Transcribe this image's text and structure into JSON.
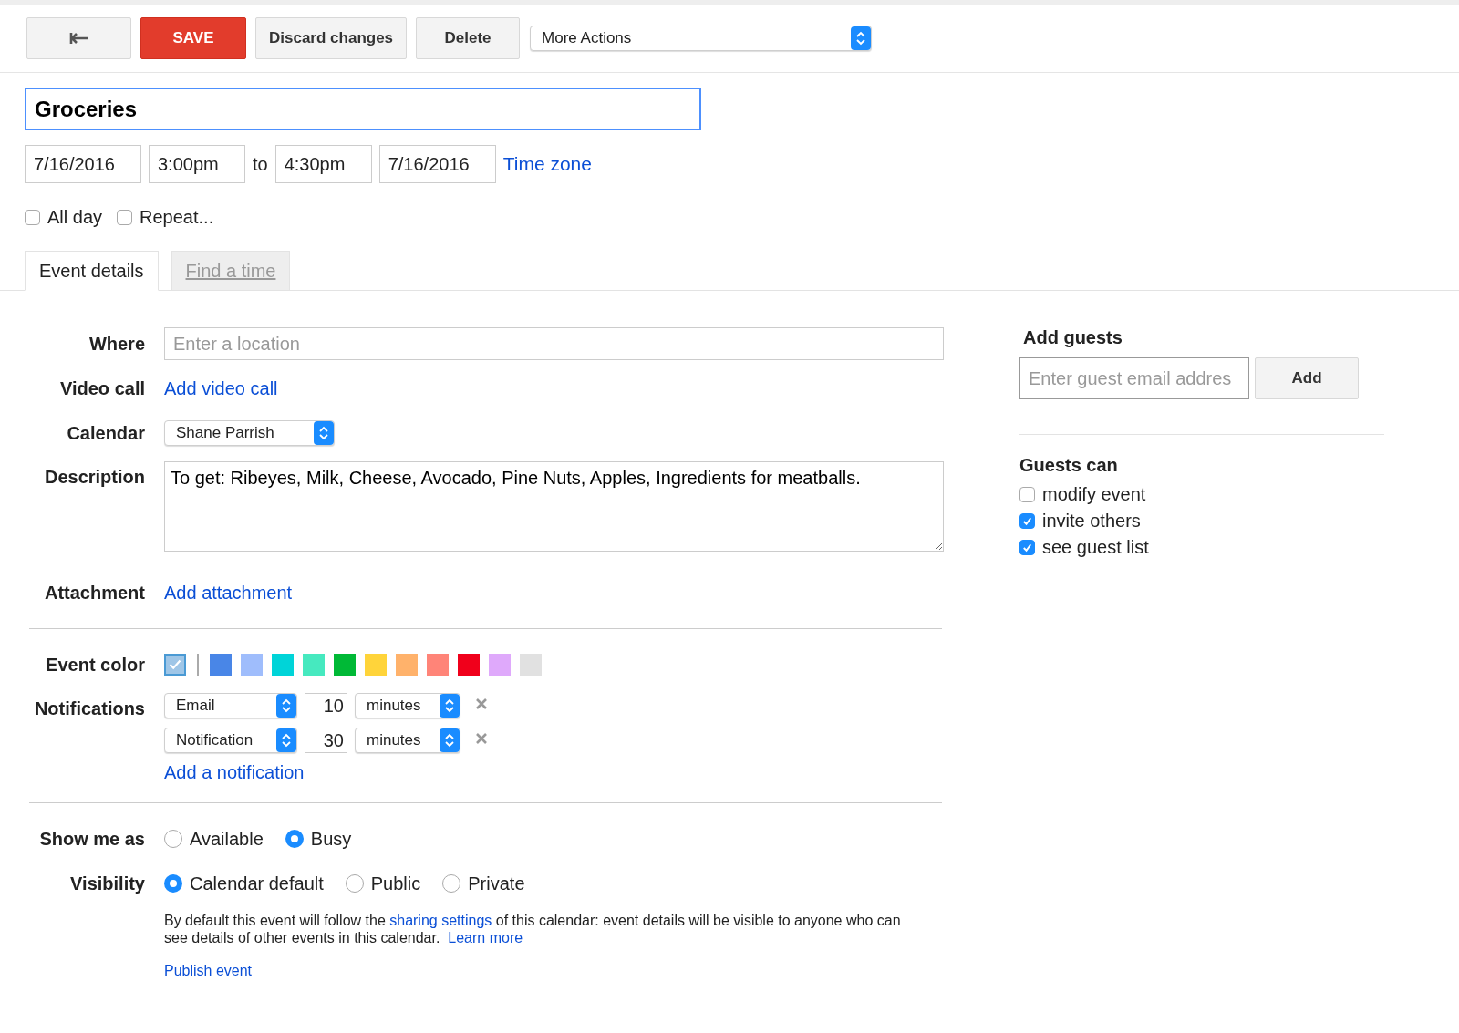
{
  "toolbar": {
    "save": "SAVE",
    "discard": "Discard changes",
    "delete": "Delete",
    "more_actions": "More Actions"
  },
  "title": "Groceries",
  "when": {
    "start_date": "7/16/2016",
    "start_time": "3:00pm",
    "to": "to",
    "end_time": "4:30pm",
    "end_date": "7/16/2016",
    "time_zone": "Time zone"
  },
  "options": [
    {
      "label": "All day",
      "checked": false
    },
    {
      "label": "Repeat...",
      "checked": false
    }
  ],
  "tabs": [
    {
      "label": "Event details",
      "selected": true
    },
    {
      "label": "Find a time",
      "selected": false
    }
  ],
  "where": {
    "label": "Where",
    "placeholder": "Enter a location"
  },
  "video_call": {
    "label": "Video call",
    "link": "Add video call"
  },
  "calendar": {
    "label": "Calendar",
    "value": "Shane Parrish"
  },
  "description": {
    "label": "Description",
    "value": "To get: Ribeyes, Milk, Cheese, Avocado, Pine Nuts, Apples, Ingredients for meatballs."
  },
  "attachment": {
    "label": "Attachment",
    "link": "Add attachment"
  },
  "event_color": {
    "label": "Event color",
    "swatches": [
      {
        "color": "#9fc6e7",
        "selected": true
      },
      {
        "color": "#4986e7",
        "selected": false
      },
      {
        "color": "#9fbdfc",
        "selected": false
      },
      {
        "color": "#00d4d8",
        "selected": false
      },
      {
        "color": "#46e9bf",
        "selected": false
      },
      {
        "color": "#00b936",
        "selected": false
      },
      {
        "color": "#ffd43a",
        "selected": false
      },
      {
        "color": "#ffb26b",
        "selected": false
      },
      {
        "color": "#ff8478",
        "selected": false
      },
      {
        "color": "#f0001b",
        "selected": false
      },
      {
        "color": "#dfa9fb",
        "selected": false
      },
      {
        "color": "#e1e1e1",
        "selected": false
      }
    ]
  },
  "notifications": {
    "label": "Notifications",
    "items": [
      {
        "method": "Email",
        "amount": "10",
        "unit": "minutes"
      },
      {
        "method": "Notification",
        "amount": "30",
        "unit": "minutes"
      }
    ],
    "add": "Add a notification"
  },
  "show_me_as": {
    "label": "Show me as",
    "choices": [
      {
        "label": "Available",
        "selected": false
      },
      {
        "label": "Busy",
        "selected": true
      }
    ]
  },
  "visibility": {
    "label": "Visibility",
    "choices": [
      {
        "label": "Calendar default",
        "selected": true
      },
      {
        "label": "Public",
        "selected": false
      },
      {
        "label": "Private",
        "selected": false
      }
    ],
    "note_before": "By default this event will follow the",
    "note_link": "sharing settings",
    "note_after": "of this calendar: event details will be visible to anyone who can see details of other events in this calendar.",
    "learn_more": "Learn more",
    "publish": "Publish event"
  },
  "guests": {
    "title": "Add guests",
    "placeholder": "Enter guest email addres",
    "add": "Add",
    "can_title": "Guests can",
    "permissions": [
      {
        "label": "modify event",
        "checked": false
      },
      {
        "label": "invite others",
        "checked": true
      },
      {
        "label": "see guest list",
        "checked": true
      }
    ]
  }
}
